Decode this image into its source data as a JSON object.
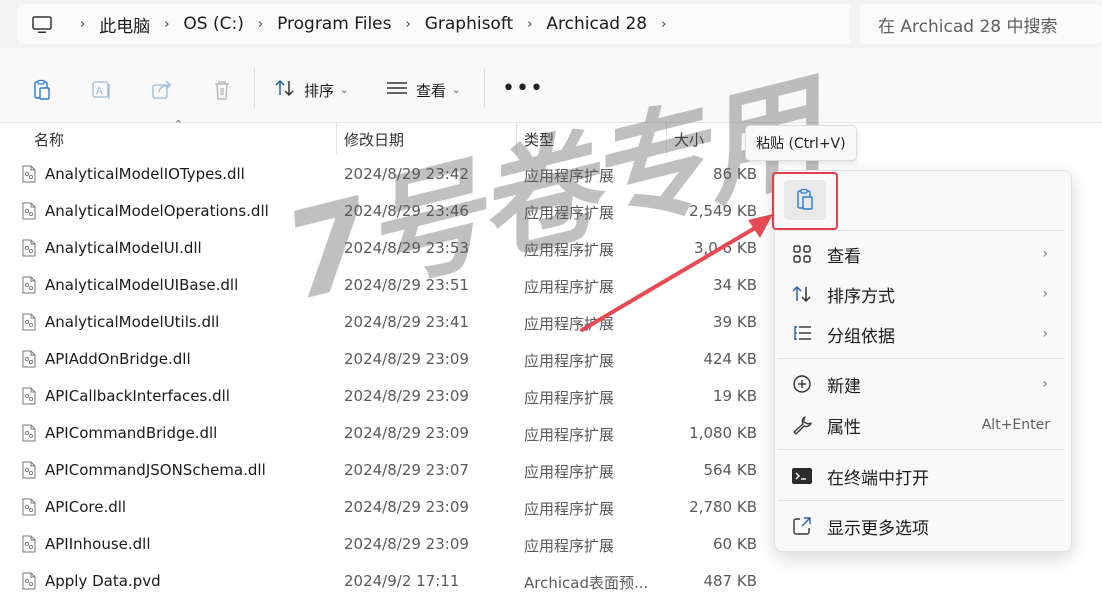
{
  "breadcrumbs": [
    "此电脑",
    "OS (C:)",
    "Program Files",
    "Graphisoft",
    "Archicad 28"
  ],
  "search": {
    "placeholder": "在 Archicad 28 中搜索"
  },
  "toolbar": {
    "sort_label": "排序",
    "view_label": "查看",
    "more_label": "•••"
  },
  "columns": {
    "name": "名称",
    "modified": "修改日期",
    "type": "类型",
    "size": "大小"
  },
  "files": [
    {
      "name": "AnalyticalModelIOTypes.dll",
      "modified": "2024/8/29 23:42",
      "type": "应用程序扩展",
      "size": "86 KB"
    },
    {
      "name": "AnalyticalModelOperations.dll",
      "modified": "2024/8/29 23:46",
      "type": "应用程序扩展",
      "size": "2,549 KB"
    },
    {
      "name": "AnalyticalModelUI.dll",
      "modified": "2024/8/29 23:53",
      "type": "应用程序扩展",
      "size": "3,0 6 KB"
    },
    {
      "name": "AnalyticalModelUIBase.dll",
      "modified": "2024/8/29 23:51",
      "type": "应用程序扩展",
      "size": "34 KB"
    },
    {
      "name": "AnalyticalModelUtils.dll",
      "modified": "2024/8/29 23:41",
      "type": "应用程序扩展",
      "size": "39 KB"
    },
    {
      "name": "APIAddOnBridge.dll",
      "modified": "2024/8/29 23:09",
      "type": "应用程序扩展",
      "size": "424 KB"
    },
    {
      "name": "APICallbackInterfaces.dll",
      "modified": "2024/8/29 23:09",
      "type": "应用程序扩展",
      "size": "19 KB"
    },
    {
      "name": "APICommandBridge.dll",
      "modified": "2024/8/29 23:09",
      "type": "应用程序扩展",
      "size": "1,080 KB"
    },
    {
      "name": "APICommandJSONSchema.dll",
      "modified": "2024/8/29 23:07",
      "type": "应用程序扩展",
      "size": "564 KB"
    },
    {
      "name": "APICore.dll",
      "modified": "2024/8/29 23:09",
      "type": "应用程序扩展",
      "size": "2,780 KB"
    },
    {
      "name": "APIInhouse.dll",
      "modified": "2024/8/29 23:09",
      "type": "应用程序扩展",
      "size": "60 KB"
    },
    {
      "name": "Apply Data.pvd",
      "modified": "2024/9/2 17:11",
      "type": "Archicad表面预...",
      "size": "487 KB"
    }
  ],
  "tooltip": "粘贴 (Ctrl+V)",
  "context_menu": {
    "view": "查看",
    "sort": "排序方式",
    "group": "分组依据",
    "new": "新建",
    "properties": "属性",
    "properties_shortcut": "Alt+Enter",
    "terminal": "在终端中打开",
    "more_options": "显示更多选项"
  },
  "watermark": "7号卷专用",
  "colors": {
    "highlight": "#e0404a",
    "arrow": "#e84a55"
  }
}
